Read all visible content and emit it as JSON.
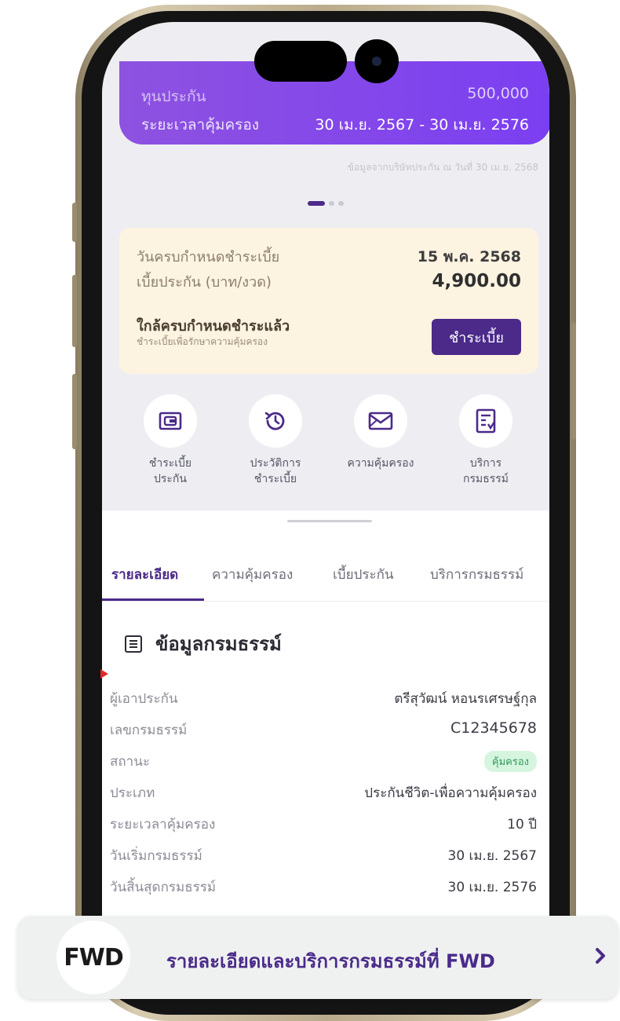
{
  "policy_card": {
    "sum_insured_label": "ทุนประกัน",
    "sum_insured_value": "500,000",
    "coverage_period_label": "ระยะเวลาคุ้มครอง",
    "coverage_period_value": "30 เม.ย. 2567 - 30 เม.ย. 2576",
    "data_note": "ข้อมูลจากบริษัทประกัน ณ วันที่ 30 เม.ย. 2568",
    "carousel_pages": 3,
    "carousel_active": 1
  },
  "due": {
    "due_date_label": "วันครบกำหนดชำระเบี้ย",
    "due_date_value": "15 พ.ค. 2568",
    "premium_label": "เบี้ยประกัน (บาท/งวด)",
    "premium_value": "4,900.00",
    "reminder_title": "ใกล้ครบกำหนดชำระแล้ว",
    "reminder_sub": "ชำระเบี้ยเพื่อรักษาความคุ้มครอง",
    "pay_button": "ชำระเบี้ย"
  },
  "quick_actions": [
    {
      "label": "ชำระเบี้ย\nประกัน",
      "icon": "wallet-icon"
    },
    {
      "label": "ประวัติการ\nชำระเบี้ย",
      "icon": "history-icon"
    },
    {
      "label": "ความคุ้มครอง",
      "icon": "mail-icon"
    },
    {
      "label": "บริการ\nกรมธรรม์",
      "icon": "document-icon"
    }
  ],
  "tabs": [
    "รายละเอียด",
    "ความคุ้มครอง",
    "เบี้ยประกัน",
    "บริการกรมธรรม์"
  ],
  "active_tab": 0,
  "policy_info": {
    "title": "ข้อมูลกรมธรรม์",
    "rows": [
      {
        "label": "ผู้เอาประกัน",
        "value": "ตรีสุวัฒน์ หอนรเศรษฐ์กุล"
      },
      {
        "label": "เลขกรมธรรม์",
        "value": "C12345678"
      },
      {
        "label": "สถานะ",
        "value": "คุ้มครอง"
      },
      {
        "label": "ประเภท",
        "value": "ประกันชีวิต-เพื่อความคุ้มครอง"
      },
      {
        "label": "ระยะเวลาคุ้มครอง",
        "value": "10 ปี"
      },
      {
        "label": "วันเริ่มกรมธรรม์",
        "value": "30 เม.ย. 2567"
      },
      {
        "label": "วันสิ้นสุดกรมธรรม์",
        "value": "30 เม.ย. 2576"
      }
    ]
  },
  "banner": {
    "logo": "FWD",
    "text": "รายละเอียดและบริการกรมธรรม์ที่ FWD"
  },
  "colors": {
    "brand_purple": "#4b2a8a",
    "card_gradient_start": "#8e52e0",
    "card_gradient_end": "#7b3ff2",
    "due_card_bg": "#fdf3e1",
    "status_badge_bg": "#d6f5df",
    "status_badge_text": "#2f9b5a"
  }
}
